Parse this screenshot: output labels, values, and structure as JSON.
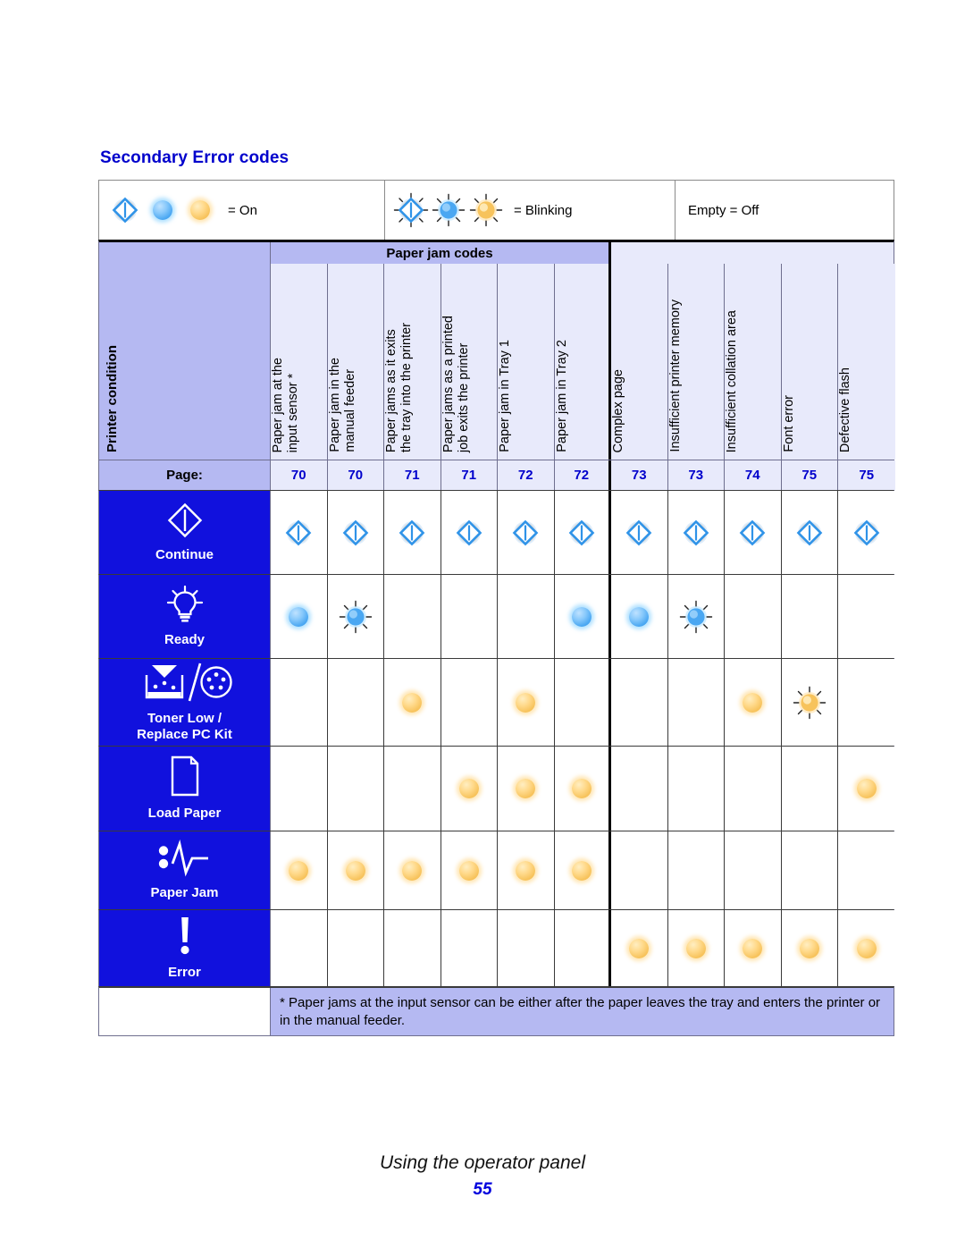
{
  "document": {
    "section_title": "Secondary Error codes",
    "footer_title": "Using the operator panel",
    "footer_page_number": "55"
  },
  "colors": {
    "heading_blue": "#0000cc",
    "condition_blue": "#1111dd",
    "header_lavender": "#b5b9f2",
    "cell_lavender": "#e8eafb",
    "lamp_blue": "#4aa7f2",
    "lamp_amber": "#f7c35c"
  },
  "legend": {
    "entries": [
      {
        "icons": [
          "continue-diamond-on",
          "blue-round-on",
          "amber-round-on"
        ],
        "label": "= On"
      },
      {
        "icons": [
          "continue-diamond-blinking",
          "blue-round-blinking",
          "amber-round-blinking"
        ],
        "label": "= Blinking"
      },
      {
        "icons": [],
        "label": "Empty = Off"
      }
    ]
  },
  "table": {
    "row_header_label": "Printer condition",
    "group_header": "Paper jam codes",
    "page_row_label": "Page:",
    "columns": [
      {
        "header": "Paper jam at the\ninput sensor *",
        "page": "70",
        "group": "paper-jam-codes"
      },
      {
        "header": "Paper jam in the\nmanual feeder",
        "page": "70",
        "group": "paper-jam-codes"
      },
      {
        "header": "Paper jams as it exits\nthe tray into the printer",
        "page": "71",
        "group": "paper-jam-codes"
      },
      {
        "header": "Paper jams as a printed\njob exits the printer",
        "page": "71",
        "group": "paper-jam-codes"
      },
      {
        "header": "Paper jam in Tray 1",
        "page": "72",
        "group": "paper-jam-codes"
      },
      {
        "header": "Paper jam in Tray 2",
        "page": "72",
        "group": "paper-jam-codes"
      },
      {
        "header": "Complex page",
        "page": "73",
        "group": "other"
      },
      {
        "header": "Insufficient printer memory",
        "page": "73",
        "group": "other"
      },
      {
        "header": "Insufficient collation area",
        "page": "74",
        "group": "other"
      },
      {
        "header": "Font error",
        "page": "75",
        "group": "other"
      },
      {
        "header": "Defective flash",
        "page": "75",
        "group": "other"
      }
    ],
    "rows": [
      {
        "label": "Continue",
        "icon": "continue-diamond-icon",
        "lamp": "diamond",
        "states": [
          "on",
          "on",
          "on",
          "on",
          "on",
          "on",
          "on",
          "on",
          "on",
          "on",
          "on"
        ]
      },
      {
        "label": "Ready",
        "icon": "lightbulb-icon",
        "lamp": "blue",
        "states": [
          "on",
          "blinking",
          "off",
          "off",
          "off",
          "on",
          "on",
          "blinking",
          "off",
          "off",
          "off"
        ]
      },
      {
        "label": "Toner Low /\nReplace PC Kit",
        "icon": "toner-cartridge-icon",
        "lamp": "amber",
        "states": [
          "off",
          "off",
          "on",
          "off",
          "on",
          "off",
          "off",
          "off",
          "on",
          "blinking",
          "off"
        ]
      },
      {
        "label": "Load Paper",
        "icon": "paper-sheet-icon",
        "lamp": "amber",
        "states": [
          "off",
          "off",
          "off",
          "on",
          "on",
          "on",
          "off",
          "off",
          "off",
          "off",
          "on"
        ]
      },
      {
        "label": "Paper Jam",
        "icon": "paper-jam-icon",
        "lamp": "amber",
        "states": [
          "on",
          "on",
          "on",
          "on",
          "on",
          "on",
          "off",
          "off",
          "off",
          "off",
          "off"
        ]
      },
      {
        "label": "Error",
        "icon": "exclamation-icon",
        "lamp": "amber",
        "states": [
          "off",
          "off",
          "off",
          "off",
          "off",
          "off",
          "on",
          "on",
          "on",
          "on",
          "on"
        ]
      }
    ],
    "footnote": "* Paper jams at the input sensor can be either after the paper leaves the tray and enters the printer or in the manual feeder."
  }
}
